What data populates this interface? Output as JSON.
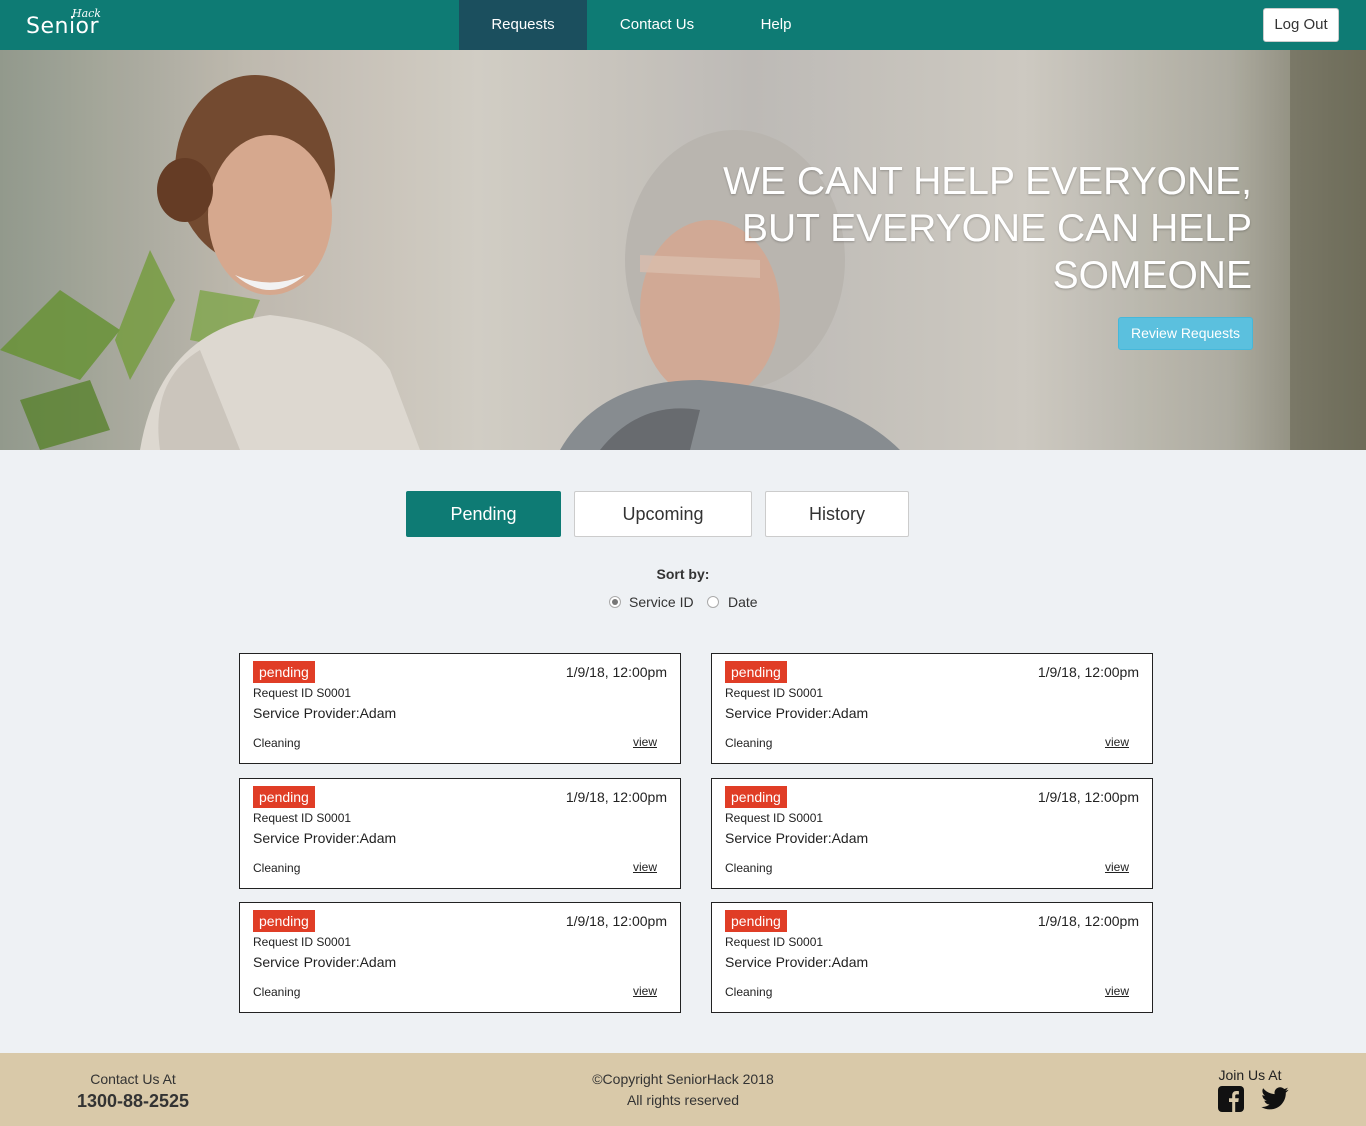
{
  "brand": {
    "name": "Senior",
    "superscript": "Hack"
  },
  "nav": {
    "items": [
      {
        "label": "Requests",
        "active": true
      },
      {
        "label": "Contact Us",
        "active": false
      },
      {
        "label": "Help",
        "active": false
      }
    ],
    "logout_label": "Log Out"
  },
  "hero": {
    "headline_line1": "WE CANT HELP EVERYONE,",
    "headline_line2": "BUT EVERYONE CAN HELP",
    "headline_line3": "SOMEONE",
    "cta_label": "Review Requests"
  },
  "tabs": [
    {
      "label": "Pending",
      "active": true
    },
    {
      "label": "Upcoming",
      "active": false
    },
    {
      "label": "History",
      "active": false
    }
  ],
  "sort": {
    "label": "Sort by:",
    "options": [
      {
        "label": "Service ID",
        "checked": true
      },
      {
        "label": "Date",
        "checked": false
      }
    ]
  },
  "requests": [
    {
      "status": "pending",
      "datetime": "1/9/18, 12:00pm",
      "request_id": "Request ID S0001",
      "provider": "Service Provider:Adam",
      "service": "Cleaning",
      "link": "view"
    },
    {
      "status": "pending",
      "datetime": "1/9/18, 12:00pm",
      "request_id": "Request ID S0001",
      "provider": "Service Provider:Adam",
      "service": "Cleaning",
      "link": "view"
    },
    {
      "status": "pending",
      "datetime": "1/9/18, 12:00pm",
      "request_id": "Request ID S0001",
      "provider": "Service Provider:Adam",
      "service": "Cleaning",
      "link": "view"
    },
    {
      "status": "pending",
      "datetime": "1/9/18, 12:00pm",
      "request_id": "Request ID S0001",
      "provider": "Service Provider:Adam",
      "service": "Cleaning",
      "link": "view"
    },
    {
      "status": "pending",
      "datetime": "1/9/18, 12:00pm",
      "request_id": "Request ID S0001",
      "provider": "Service Provider:Adam",
      "service": "Cleaning",
      "link": "view"
    },
    {
      "status": "pending",
      "datetime": "1/9/18, 12:00pm",
      "request_id": "Request ID S0001",
      "provider": "Service Provider:Adam",
      "service": "Cleaning",
      "link": "view"
    }
  ],
  "footer": {
    "contact_label": "Contact Us At",
    "phone": "1300-88-2525",
    "copyright": "©Copyright SeniorHack 2018",
    "rights": "All rights reserved",
    "join_label": "Join Us At",
    "social": [
      "facebook-icon",
      "twitter-icon"
    ]
  },
  "colors": {
    "primary": "#0e7b74",
    "nav_active": "#1b4f5e",
    "cta": "#5bc0de",
    "status_pending": "#e03d26",
    "footer_bg": "#d9c9a9"
  }
}
